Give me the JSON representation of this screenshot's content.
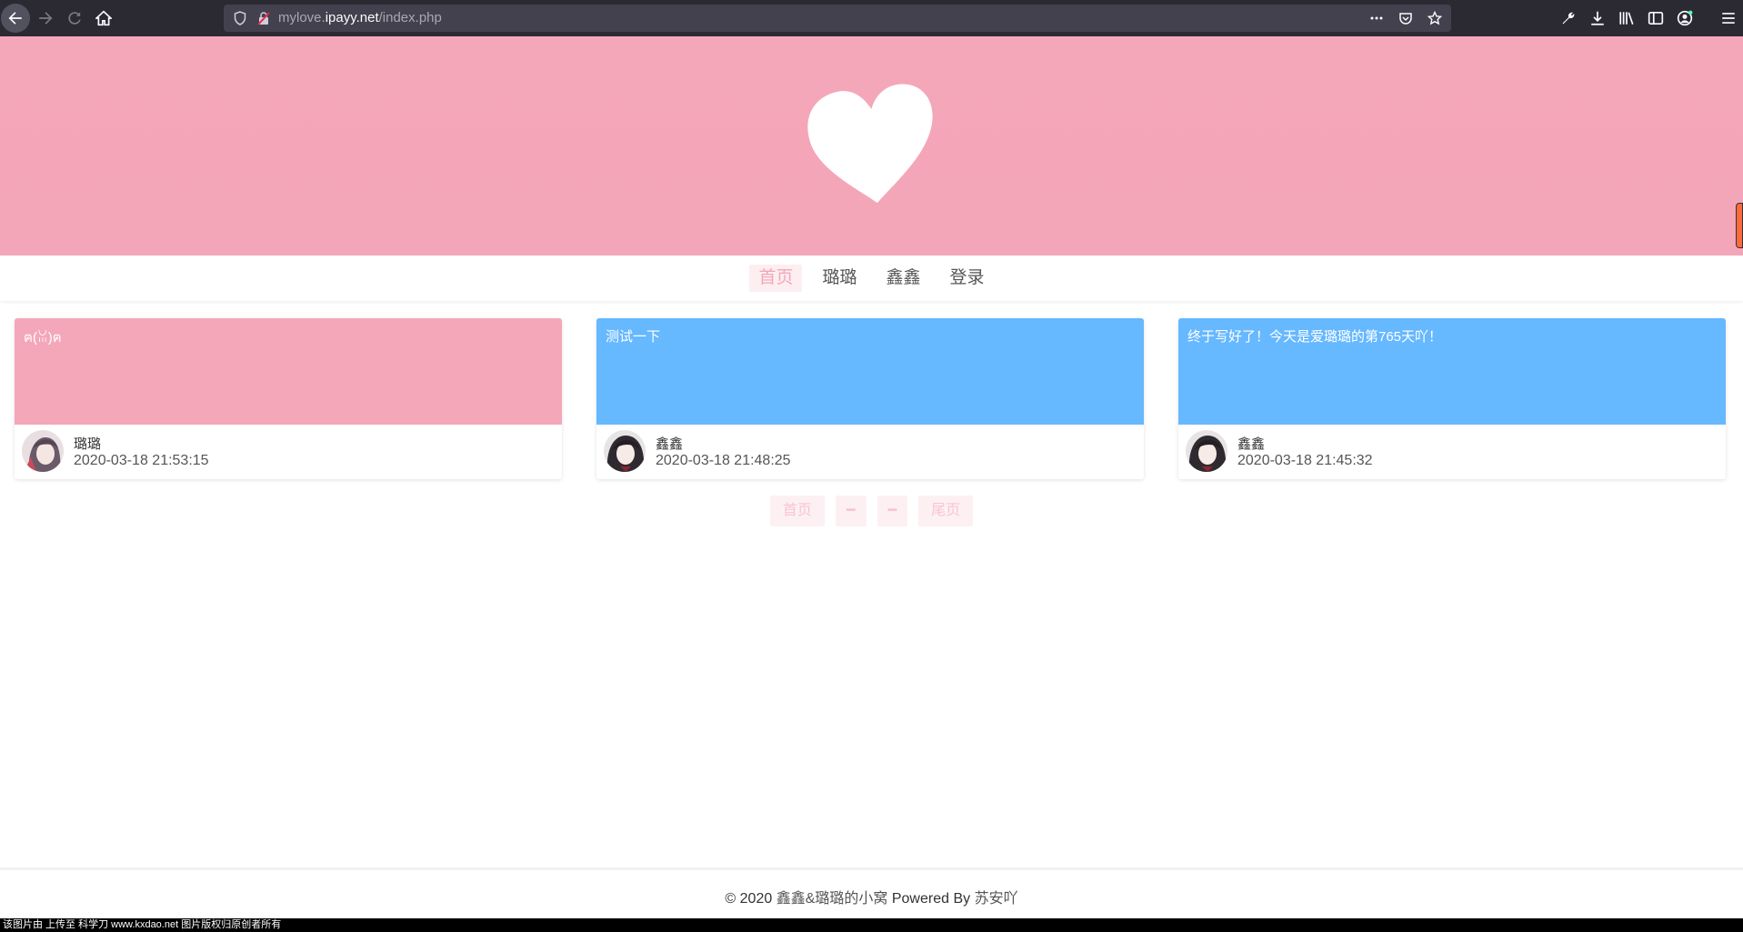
{
  "browser": {
    "url_prefix": "mylove.",
    "url_host": "ipayy.net",
    "url_path": "/index.php"
  },
  "nav": {
    "items": [
      {
        "label": "首页",
        "active": true
      },
      {
        "label": "璐璐",
        "active": false
      },
      {
        "label": "鑫鑫",
        "active": false
      },
      {
        "label": "登录",
        "active": false
      }
    ]
  },
  "posts": [
    {
      "content": "ฅ(ꈍ)ฅ",
      "author": "璐璐",
      "time": "2020-03-18 21:53:15",
      "color": "#f4a7b9"
    },
    {
      "content": "测试一下",
      "author": "鑫鑫",
      "time": "2020-03-18 21:48:25",
      "color": "#66b8ff"
    },
    {
      "content": "终于写好了！今天是爱璐璐的第765天吖！",
      "author": "鑫鑫",
      "time": "2020-03-18 21:45:32",
      "color": "#66b8ff"
    }
  ],
  "pager": {
    "first": "首页",
    "prev": "━",
    "next": "━",
    "last": "尾页"
  },
  "footer": {
    "copyright": "© 2020",
    "site_name": "鑫鑫&璐璐的小窝",
    "powered": "Powered By",
    "author": "苏安吖"
  },
  "status_bar": "该图片由  上传至 科学刀 www.kxdao.net 图片版权归原创者所有",
  "colors": {
    "accent_pink": "#f4a7b9",
    "accent_blue": "#66b8ff",
    "chrome_bg": "#2b2a33"
  }
}
